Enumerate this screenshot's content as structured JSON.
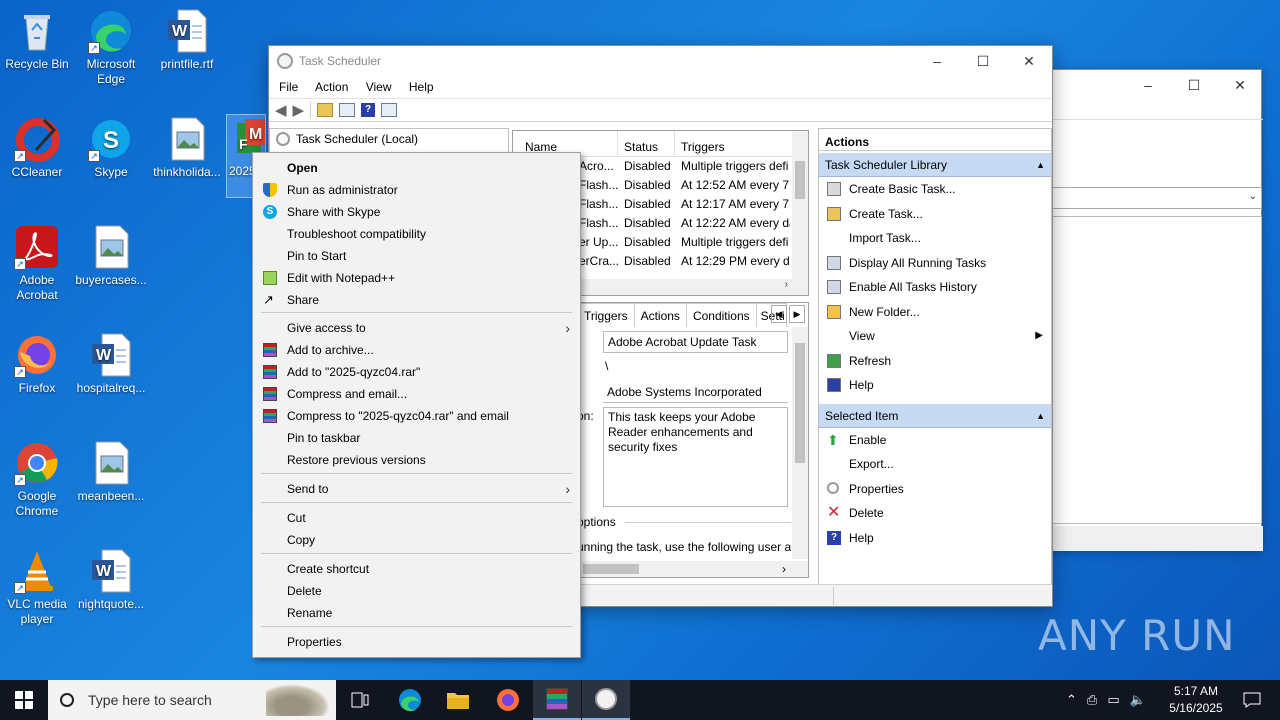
{
  "desktop": {
    "icons": [
      {
        "label": "Recycle Bin"
      },
      {
        "label": "Microsoft Edge"
      },
      {
        "label": "printfile.rtf"
      },
      {
        "label": "CCleaner"
      },
      {
        "label": "Skype"
      },
      {
        "label": "thinkholida..."
      },
      {
        "label": "2025"
      },
      {
        "label": "Adobe Acrobat"
      },
      {
        "label": "buyercases..."
      },
      {
        "label": "Firefox"
      },
      {
        "label": "hospitalreq..."
      },
      {
        "label": "Google Chrome"
      },
      {
        "label": "meanbeen..."
      },
      {
        "label": "VLC media player"
      },
      {
        "label": "nightquote..."
      }
    ]
  },
  "task_scheduler": {
    "title": "Task Scheduler",
    "menu": [
      "File",
      "Action",
      "View",
      "Help"
    ],
    "tree_root": "Task Scheduler (Local)",
    "columns": [
      "Name",
      "Status",
      "Triggers"
    ],
    "rows": [
      {
        "name": "Acro...",
        "status": "Disabled",
        "trigger": "Multiple triggers defi"
      },
      {
        "name": "Flash...",
        "status": "Disabled",
        "trigger": "At 12:52 AM every 7 d"
      },
      {
        "name": "Flash...",
        "status": "Disabled",
        "trigger": "At 12:17 AM every 7 d"
      },
      {
        "name": "Flash...",
        "status": "Disabled",
        "trigger": "At 12:22 AM every da"
      },
      {
        "name": "er Up...",
        "status": "Disabled",
        "trigger": "Multiple triggers defi"
      },
      {
        "name": "erCra...",
        "status": "Disabled",
        "trigger": "At 12:29 PM every da"
      }
    ],
    "detail_tabs": [
      "Triggers",
      "Actions",
      "Conditions",
      "Setti"
    ],
    "detail": {
      "task_name": "Adobe Acrobat Update Task",
      "location": "\\",
      "author": "Adobe Systems Incorporated",
      "desc_label": "on:",
      "description": "This task keeps your Adobe Reader enhancements and security fixes",
      "options_label": "options",
      "run_text": "unning the task, use the following user a"
    },
    "actions": {
      "header": "Actions",
      "library_header": "Task Scheduler Library",
      "library_items": [
        "Create Basic Task...",
        "Create Task...",
        "Import Task...",
        "Display All Running Tasks",
        "Enable All Tasks History",
        "New Folder...",
        "View",
        "Refresh",
        "Help"
      ],
      "selected_header": "Selected Item",
      "selected_items": [
        "Enable",
        "Export...",
        "Properties",
        "Delete",
        "Help"
      ]
    }
  },
  "context_menu": {
    "items": [
      {
        "label": "Open",
        "icon": "none"
      },
      {
        "label": "Run as administrator",
        "icon": "shield-icon"
      },
      {
        "label": "Share with Skype",
        "icon": "skype-icon"
      },
      {
        "label": "Troubleshoot compatibility",
        "icon": "none"
      },
      {
        "label": "Pin to Start",
        "icon": "none"
      },
      {
        "label": "Edit with Notepad++",
        "icon": "notepad-icon"
      },
      {
        "label": "Share",
        "icon": "share-icon"
      },
      {
        "label": "Give access to",
        "icon": "none"
      },
      {
        "label": "Add to archive...",
        "icon": "winrar-icon"
      },
      {
        "label": "Add to \"2025-qyzc04.rar\"",
        "icon": "winrar-icon"
      },
      {
        "label": "Compress and email...",
        "icon": "winrar-icon"
      },
      {
        "label": "Compress to \"2025-qyzc04.rar\" and email",
        "icon": "winrar-icon"
      },
      {
        "label": "Pin to taskbar",
        "icon": "none"
      },
      {
        "label": "Restore previous versions",
        "icon": "none"
      },
      {
        "label": "Send to",
        "icon": "none"
      },
      {
        "label": "Cut",
        "icon": "none"
      },
      {
        "label": "Copy",
        "icon": "none"
      },
      {
        "label": "Create shortcut",
        "icon": "none"
      },
      {
        "label": "Delete",
        "icon": "none"
      },
      {
        "label": "Rename",
        "icon": "none"
      },
      {
        "label": "Properties",
        "icon": "none"
      }
    ]
  },
  "taskbar": {
    "search_placeholder": "Type here to search",
    "time": "5:17 AM",
    "date": "5/16/2025"
  },
  "watermark": "ANY RUN"
}
